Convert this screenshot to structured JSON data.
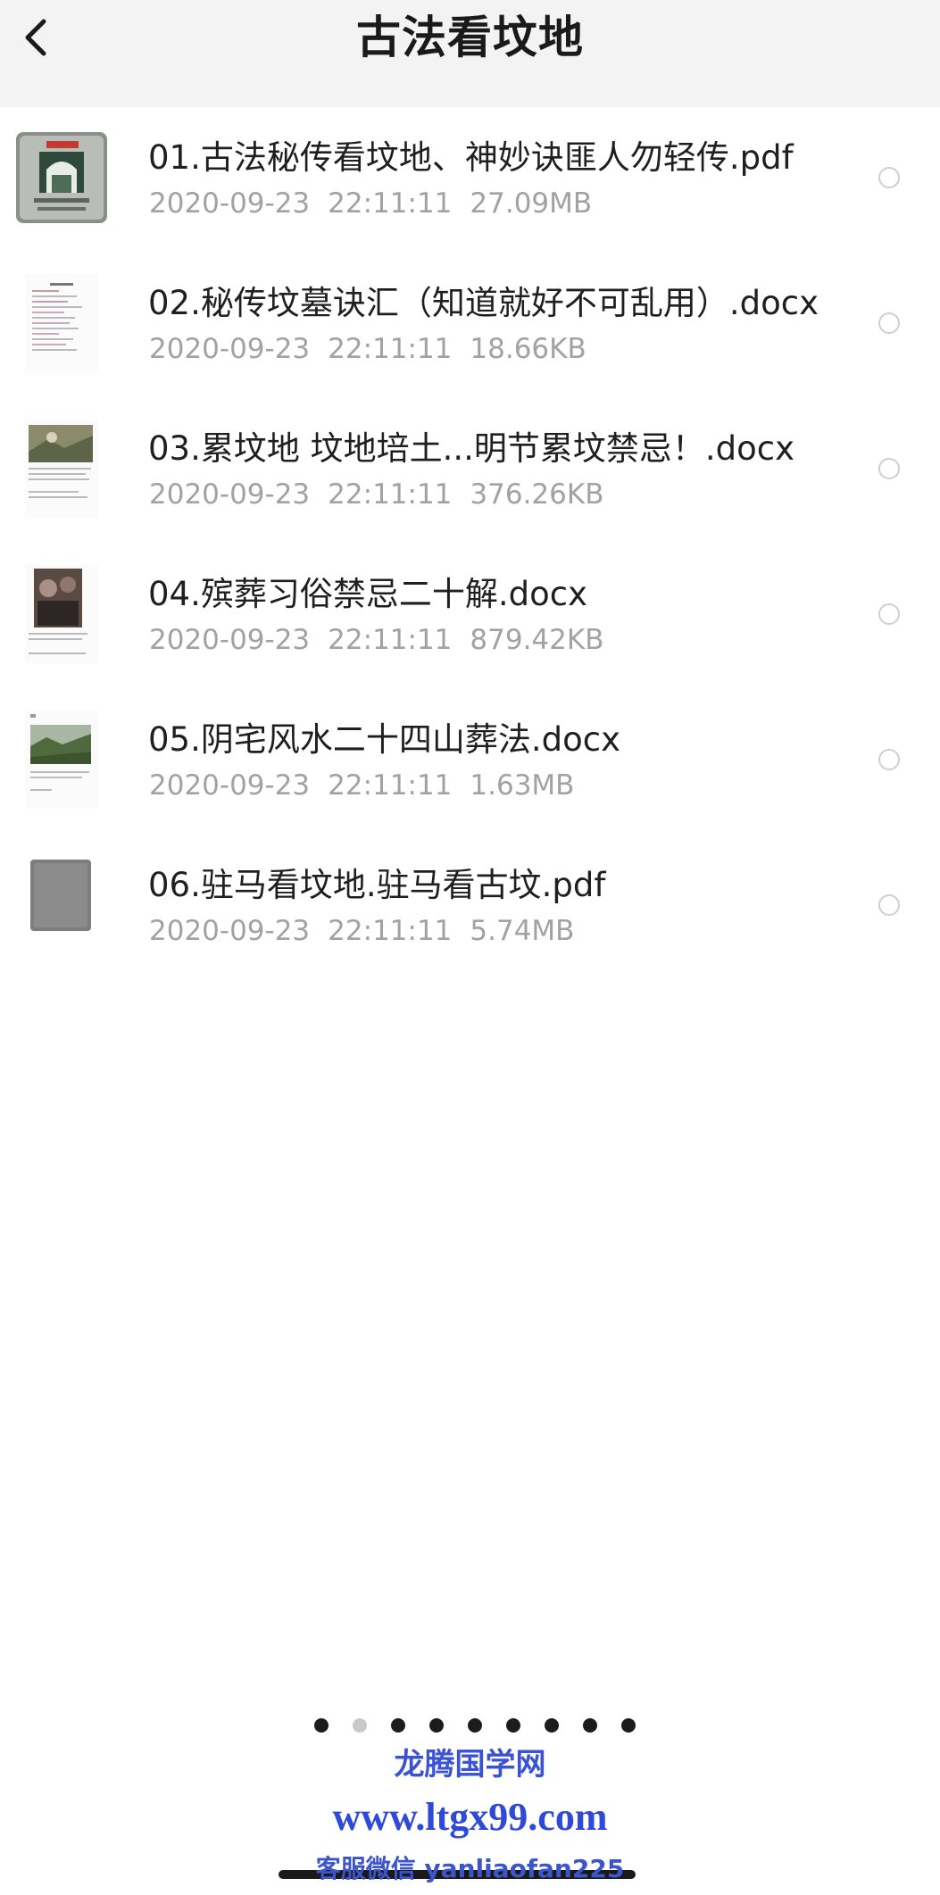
{
  "header": {
    "title": "古法看坟地",
    "back_icon": "chevron-left-icon"
  },
  "files": [
    {
      "name": "01.古法秘传看坟地、神妙诀匪人勿轻传.pdf",
      "date": "2020-09-23",
      "time": "22:11:11",
      "size": "27.09MB",
      "thumb": "book-cover"
    },
    {
      "name": "02.秘传坟墓诀汇（知道就好不可乱用）.docx",
      "date": "2020-09-23",
      "time": "22:11:11",
      "size": "18.66KB",
      "thumb": "text-page"
    },
    {
      "name": "03.累坟地 坟地培土...明节累坟禁忌！.docx",
      "date": "2020-09-23",
      "time": "22:11:11",
      "size": "376.26KB",
      "thumb": "photo-page"
    },
    {
      "name": "04.殡葬习俗禁忌二十解.docx",
      "date": "2020-09-23",
      "time": "22:11:11",
      "size": "879.42KB",
      "thumb": "photo-page"
    },
    {
      "name": "05.阴宅风水二十四山葬法.docx",
      "date": "2020-09-23",
      "time": "22:11:11",
      "size": "1.63MB",
      "thumb": "photo-page"
    },
    {
      "name": "06.驻马看坟地.驻马看古坟.pdf",
      "date": "2020-09-23",
      "time": "22:11:11",
      "size": "5.74MB",
      "thumb": "gray-cover"
    }
  ],
  "pager": {
    "count": 9,
    "active_index": 1
  },
  "watermark": {
    "site_name": "龙腾国学网",
    "url": "www.ltgx99.com",
    "contact": "客服微信 yanliaofan225"
  },
  "colors": {
    "header_bg": "#f3f3f3",
    "meta_text": "#a2a2a2",
    "watermark": "#3a52d6"
  }
}
